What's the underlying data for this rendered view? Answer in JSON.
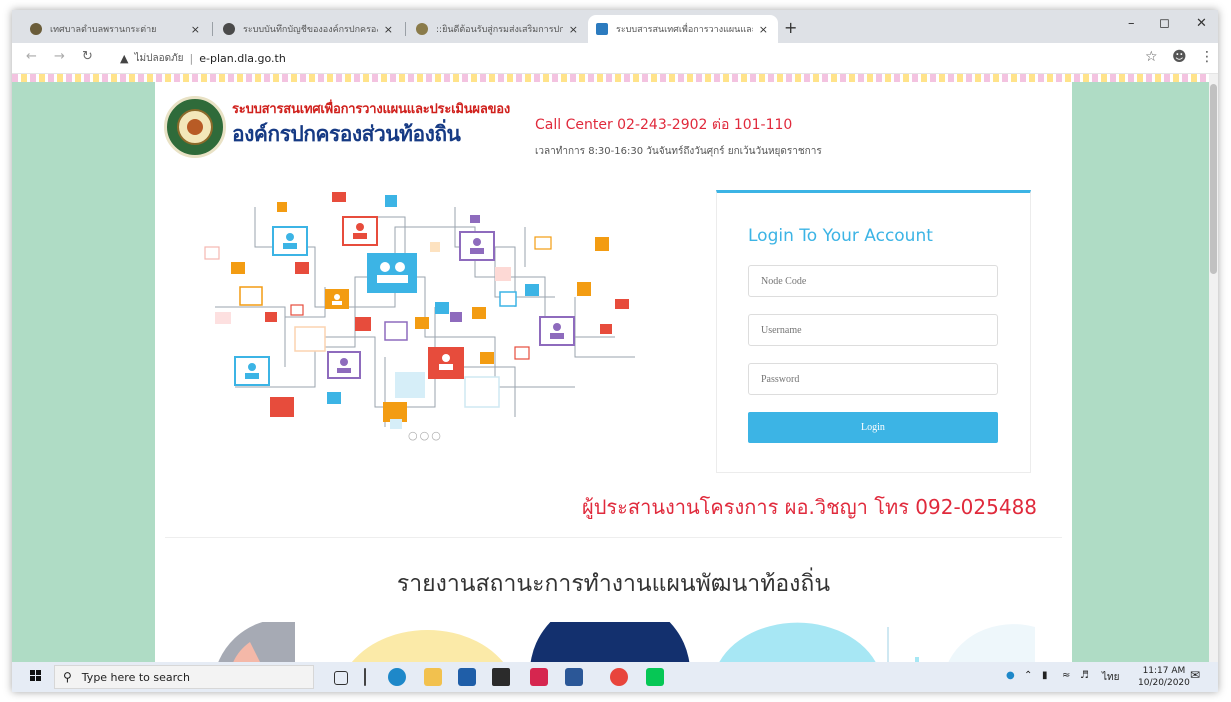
{
  "browser": {
    "tabs": [
      {
        "title": "เทศบาลตำบลพรานกระต่าย",
        "active": false
      },
      {
        "title": "ระบบบันทึกบัญชีขององค์กรปกครองส่วนท้องถิ่น",
        "active": false
      },
      {
        "title": "::ยินดีต้อนรับสู่กรมส่งเสริมการปกครองท้องถิ่น",
        "active": false
      },
      {
        "title": "ระบบสารสนเทศเพื่อการวางแผนและประเมินผล",
        "active": true
      }
    ],
    "close_glyph": "×",
    "new_tab_glyph": "+",
    "insecure_label": "ไม่ปลอดภัย",
    "url": "e-plan.dla.go.th"
  },
  "header": {
    "system_name": "ระบบสารสนเทศเพื่อการวางแผนและประเมินผลของ",
    "org_name": "องค์กรปกครองส่วนท้องถิ่น",
    "call_center": "Call Center 02-243-2902 ต่อ 101-110",
    "office_hours": "เวลาทำการ 8:30-16:30 วันจันทร์ถึงวันศุกร์ ยกเว้นวันหยุดราชการ"
  },
  "login": {
    "title": "Login To Your Account",
    "node_code_placeholder": "Node Code",
    "username_placeholder": "Username",
    "password_placeholder": "Password",
    "button_label": "Login"
  },
  "coordinator": "ผู้ประสานงานโครงการ ผอ.วิชญา โทร 092-025488",
  "report_title": "รายงานสถานะการทำงานแผนพัฒนาท้องถิ่น",
  "taskbar": {
    "search_placeholder": "Type here to search",
    "lang": "ไทย",
    "time": "11:17 AM",
    "date": "10/20/2020"
  },
  "colors": {
    "accent": "#3cb4e5",
    "red_text": "#e02a3c",
    "side_bg": "#afdcc5",
    "org_blue": "#163a84"
  }
}
